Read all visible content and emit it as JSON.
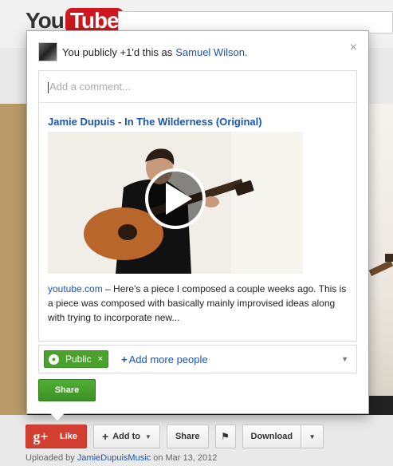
{
  "header": {
    "logo_you": "You",
    "logo_tube": "Tube"
  },
  "background": {
    "paren_text": ")"
  },
  "share_popup": {
    "avatar_alt": "Samuel Wilson avatar",
    "intro_text": "You publicly +1'd this as",
    "user_name": "Samuel Wilson.",
    "close_symbol": "×",
    "comment_placeholder": "Add a comment...",
    "link": {
      "title": "Jamie Dupuis - In The Wilderness (Original)",
      "source": "youtube.com",
      "description": " – Here's a piece I composed a couple weeks ago. This is a piece was composed with basically mainly improvised ideas along with trying to incorporate new..."
    },
    "audience": {
      "chip_label": "Public",
      "chip_remove": "×",
      "add_more_label": "Add more people"
    },
    "share_label": "Share"
  },
  "action_bar": {
    "like_g": "g+",
    "like_label": "Like",
    "add_to_label": "Add to",
    "share_label": "Share",
    "download_label": "Download"
  },
  "upload_info": {
    "prefix": "Uploaded by ",
    "uploader": "JamieDupuisMusic",
    "suffix": " on Mar 13, 2012"
  },
  "colors": {
    "link_blue": "#1a55b4",
    "share_green": "#4aa22c",
    "gplus_red": "#d23f31"
  }
}
